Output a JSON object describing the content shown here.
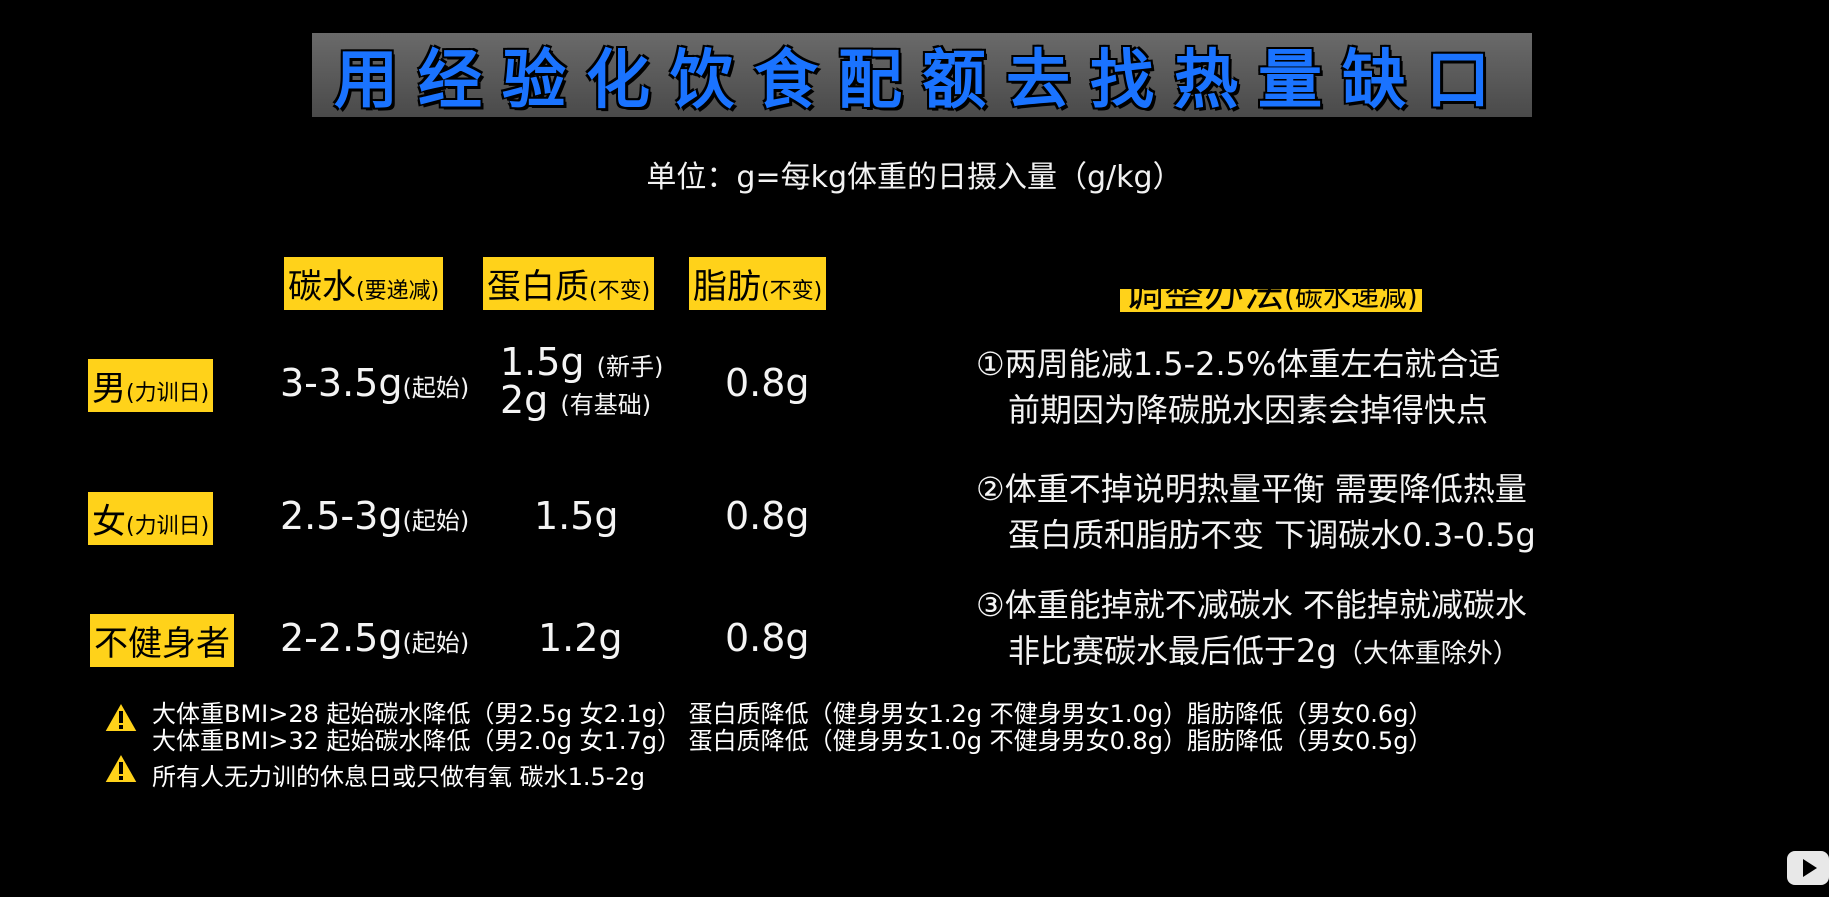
{
  "title": "用经验化饮食配额去找热量缺口",
  "unit_line": "单位：g=每kg体重的日摄入量（g/kg）",
  "columns": {
    "carb": {
      "main": "碳水",
      "note": "(要递减)"
    },
    "protein": {
      "main": "蛋白质",
      "note": "(不变)"
    },
    "fat": {
      "main": "脂肪",
      "note": "(不变)"
    }
  },
  "rows": [
    {
      "label_main": "男",
      "label_note": "(力训日)",
      "carb": "3-3.5g",
      "carb_note": "(起始)",
      "protein_line1": "1.5g",
      "protein_line1_note": "(新手)",
      "protein_line2": "2g",
      "protein_line2_note": "(有基础)",
      "fat": "0.8g"
    },
    {
      "label_main": "女",
      "label_note": "(力训日)",
      "carb": "2.5-3g",
      "carb_note": "(起始)",
      "protein": "1.5g",
      "fat": "0.8g"
    },
    {
      "label_main": "不健身者",
      "carb": "2-2.5g",
      "carb_note": "(起始)",
      "protein": "1.2g",
      "fat": "0.8g"
    }
  ],
  "adjust": {
    "heading_main": "调整办法",
    "heading_note": "(碳水递减)",
    "items": [
      {
        "line1": "①两周能减1.5-2.5%体重左右就合适",
        "line2": "前期因为降碳脱水因素会掉得快点"
      },
      {
        "line1": "②体重不掉说明热量平衡 需要降低热量",
        "line2": "蛋白质和脂肪不变 下调碳水0.3-0.5g"
      },
      {
        "line1": "③体重能掉就不减碳水 不能掉就减碳水",
        "line2": "非比赛碳水最后低于2g",
        "line2_note": "（大体重除外）"
      }
    ]
  },
  "notes": [
    "大体重BMI>28 起始碳水降低（男2.5g 女2.1g） 蛋白质降低（健身男女1.2g 不健身男女1.0g）脂肪降低（男女0.6g）",
    "大体重BMI>32 起始碳水降低（男2.0g 女1.7g） 蛋白质降低（健身男女1.0g 不健身男女0.8g）脂肪降低（男女0.5g）",
    "所有人无力训的休息日或只做有氧 碳水1.5-2g"
  ],
  "colors": {
    "accent_blue": "#1a73ff",
    "highlight_yellow": "#ffd21a",
    "warning_yellow": "#ffd21a"
  },
  "icons": [
    "warning-icon",
    "play-icon"
  ]
}
